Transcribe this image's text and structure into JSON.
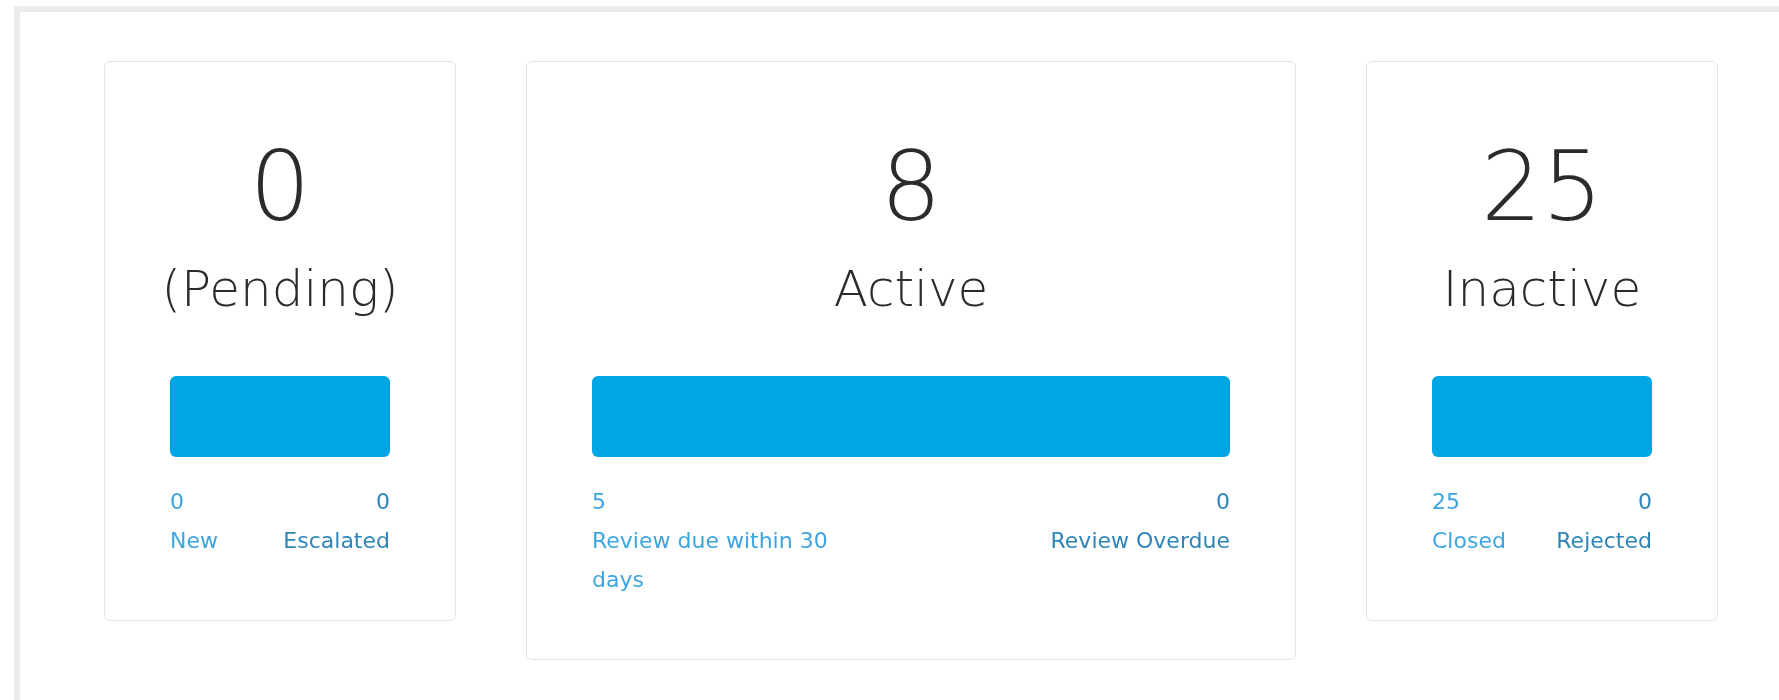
{
  "cards": [
    {
      "count": "0",
      "title": "(Pending)",
      "stats": [
        {
          "value": "0",
          "label": "New",
          "color": "#3ea5e0"
        },
        {
          "value": "0",
          "label": "Escalated",
          "color": "#2e86b8"
        }
      ]
    },
    {
      "count": "8",
      "title": "Active",
      "stats": [
        {
          "value": "5",
          "label": "Review due within 30 days",
          "color": "#3ea5e0"
        },
        {
          "value": "0",
          "label": "Review Overdue",
          "color": "#2e86b8"
        }
      ]
    },
    {
      "count": "25",
      "title": "Inactive",
      "stats": [
        {
          "value": "25",
          "label": "Closed",
          "color": "#3ea5e0"
        },
        {
          "value": "0",
          "label": "Rejected",
          "color": "#2e86b8"
        }
      ]
    }
  ]
}
